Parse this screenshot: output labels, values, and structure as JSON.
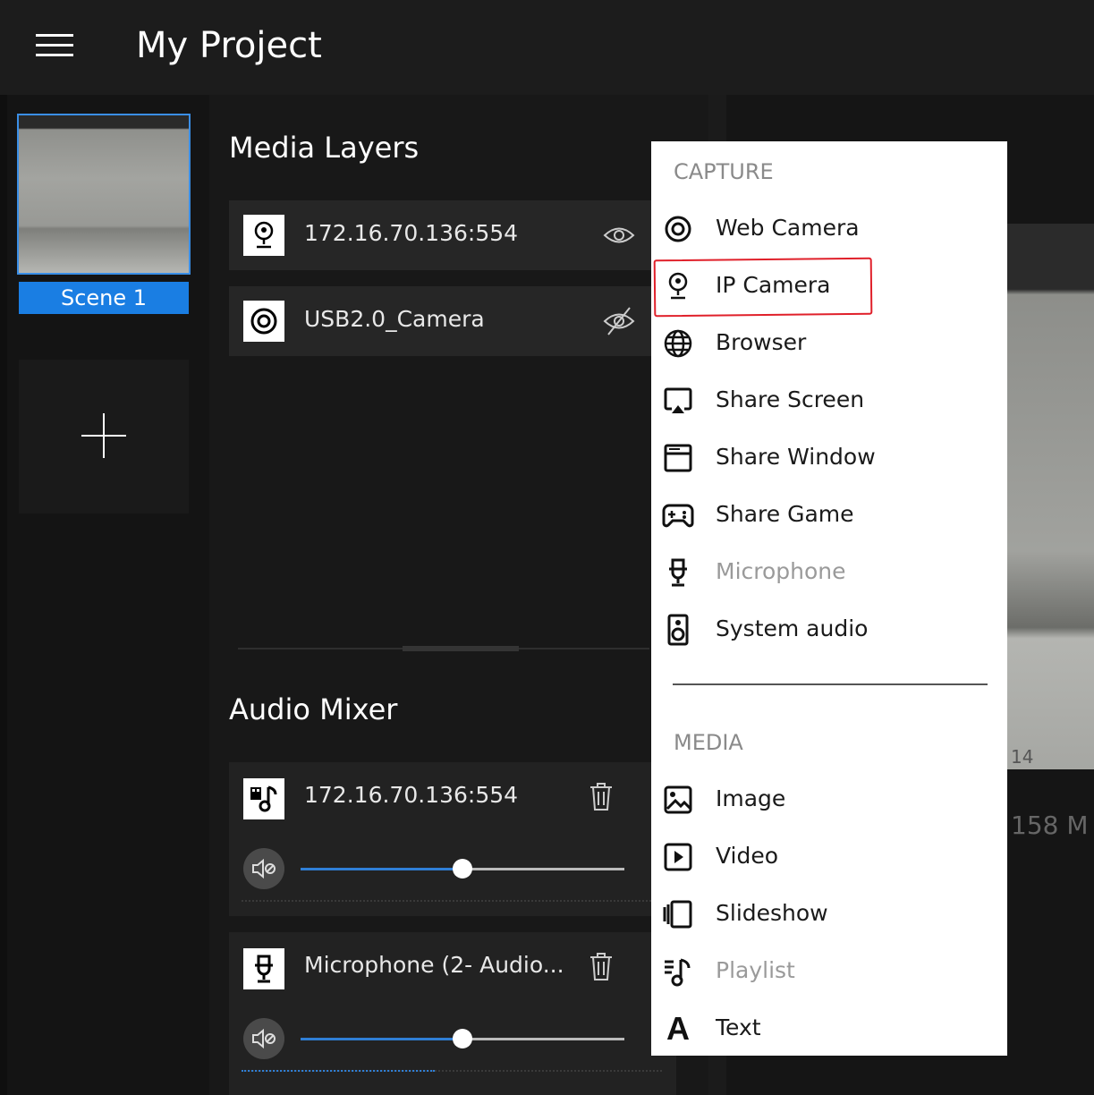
{
  "app": {
    "title": "My Project"
  },
  "scenes": {
    "items": [
      {
        "label": "Scene 1"
      }
    ]
  },
  "media_layers": {
    "title": "Media Layers",
    "items": [
      {
        "label": "172.16.70.136:554",
        "icon": "ip-camera-icon",
        "visible": true
      },
      {
        "label": "USB2.0_Camera",
        "icon": "web-camera-icon",
        "visible": false
      }
    ]
  },
  "audio_mixer": {
    "title": "Audio Mixer",
    "items": [
      {
        "label": "172.16.70.136:554",
        "icon": "media-audio-icon",
        "volume": 0.5,
        "meter": 0.0
      },
      {
        "label": "Microphone (2- Audio...",
        "icon": "microphone-icon",
        "volume": 0.5,
        "meter": 0.46
      }
    ]
  },
  "preview": {
    "partial_text": "158 M",
    "partial_small": "14"
  },
  "add_menu": {
    "capture_header": "CAPTURE",
    "capture_items": [
      {
        "label": "Web Camera",
        "icon": "web-camera-icon",
        "enabled": true
      },
      {
        "label": "IP Camera",
        "icon": "ip-camera-icon",
        "enabled": true,
        "highlighted": true
      },
      {
        "label": "Browser",
        "icon": "globe-icon",
        "enabled": true
      },
      {
        "label": "Share Screen",
        "icon": "share-screen-icon",
        "enabled": true
      },
      {
        "label": "Share Window",
        "icon": "share-window-icon",
        "enabled": true
      },
      {
        "label": "Share Game",
        "icon": "gamepad-icon",
        "enabled": true
      },
      {
        "label": "Microphone",
        "icon": "microphone-icon",
        "enabled": false
      },
      {
        "label": "System audio",
        "icon": "speaker-icon",
        "enabled": true
      }
    ],
    "media_header": "MEDIA",
    "media_items": [
      {
        "label": "Image",
        "icon": "image-icon",
        "enabled": true
      },
      {
        "label": "Video",
        "icon": "video-icon",
        "enabled": true
      },
      {
        "label": "Slideshow",
        "icon": "slideshow-icon",
        "enabled": true
      },
      {
        "label": "Playlist",
        "icon": "playlist-icon",
        "enabled": false
      },
      {
        "label": "Text",
        "icon": "text-icon",
        "enabled": true
      }
    ]
  },
  "colors": {
    "accent": "#1a7ee3",
    "highlight_box": "#e0202a"
  }
}
